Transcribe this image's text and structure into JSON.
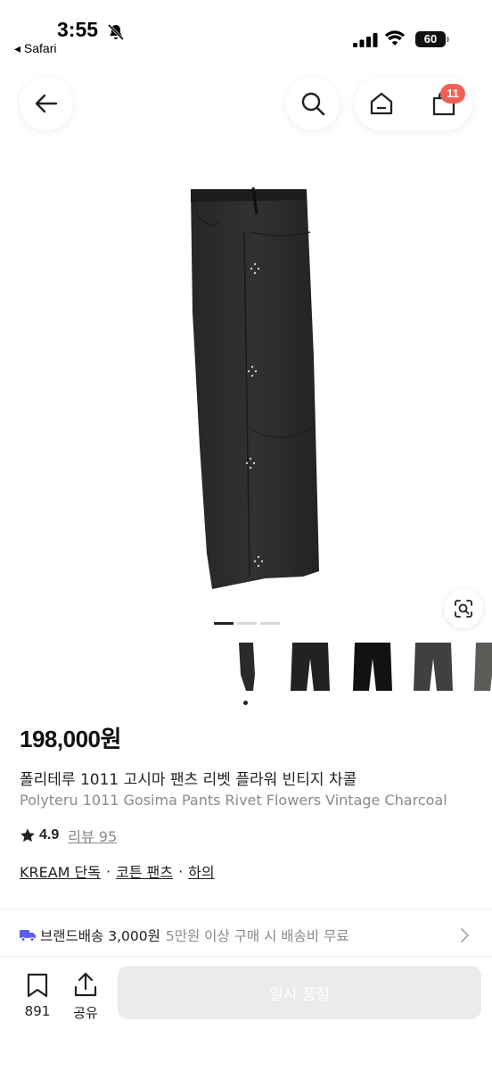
{
  "status_bar": {
    "time": "3:55",
    "back_app": "◂ Safari",
    "battery": "60"
  },
  "nav": {
    "cart_count": "11"
  },
  "product": {
    "price": "198,000원",
    "name_ko": "폴리테루 1011 고시마 팬츠 리벳 플라워 빈티지 차콜",
    "name_en": "Polyteru 1011 Gosima Pants Rivet Flowers Vintage Charcoal",
    "rating": "4.9",
    "review_label": "리뷰 95",
    "breadcrumbs": [
      "KREAM 단독",
      "코튼 팬츠",
      "하의"
    ],
    "breadcrumb_sep": "·"
  },
  "image_pager": {
    "pages": 3,
    "active": 0
  },
  "thumbnails": [
    {
      "name": "charcoal-side",
      "color": "#2a2a2c"
    },
    {
      "name": "charcoal-front",
      "color": "#222224"
    },
    {
      "name": "black-front",
      "color": "#121214"
    },
    {
      "name": "grey-front",
      "color": "#404042"
    },
    {
      "name": "olive-grey-front",
      "color": "#5a5c58"
    }
  ],
  "shipping": {
    "main": "브랜드배송 3,000원",
    "sub": "5만원 이상 구매 시 배송비 무료"
  },
  "bottom_bar": {
    "save_count": "891",
    "share_label": "공유",
    "soldout_label": "일시 품절"
  },
  "colors": {
    "badge": "#ef6253",
    "shipping_icon": "#5b5ef4",
    "soldout_bg": "#ebebeb",
    "garment": "#2b2b2d"
  }
}
